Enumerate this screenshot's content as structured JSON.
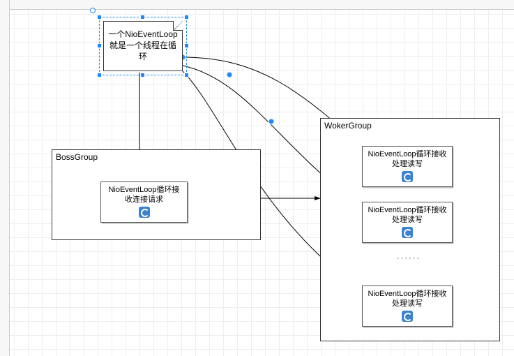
{
  "note": {
    "line1": "一个NioEventLoop",
    "line2": "就是一个线程在循环"
  },
  "bossGroup": {
    "label": "BossGroup",
    "node": "NioEventLoop循环接收连接请求"
  },
  "workerGroup": {
    "label": "WokerGroup",
    "node1": "NioEventLoop循环接收处理读写",
    "node2": "NioEventLoop循环接收处理读写",
    "node3": "NioEventLoop循环接收处理读写",
    "ellipsis": "······"
  }
}
